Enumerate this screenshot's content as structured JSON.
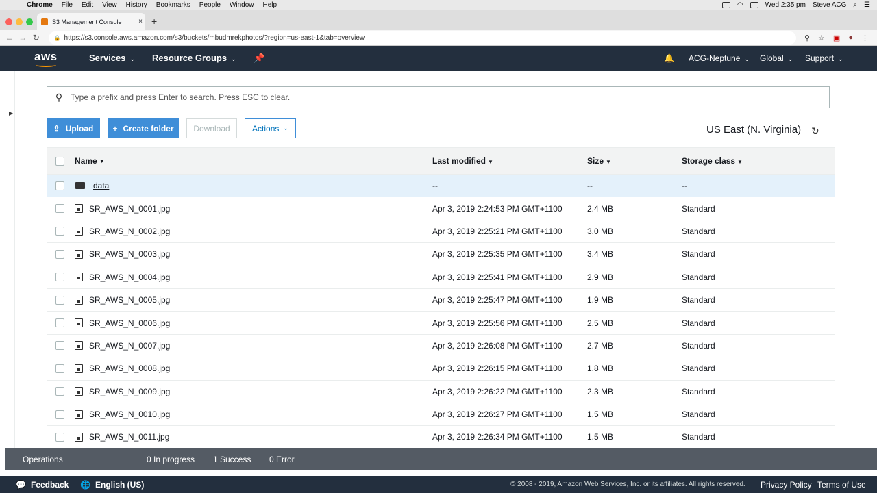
{
  "mac_menu": {
    "app": "Chrome",
    "items": [
      "File",
      "Edit",
      "View",
      "History",
      "Bookmarks",
      "People",
      "Window",
      "Help"
    ],
    "clock": "Wed 2:35 pm",
    "user": "Steve ACG"
  },
  "browser": {
    "tab_title": "S3 Management Console",
    "url": "https://s3.console.aws.amazon.com/s3/buckets/mbudmrekphotos/?region=us-east-1&tab=overview"
  },
  "aws_nav": {
    "logo": "aws",
    "services": "Services",
    "resource_groups": "Resource Groups",
    "account": "ACG-Neptune",
    "region": "Global",
    "support": "Support"
  },
  "search": {
    "placeholder": "Type a prefix and press Enter to search. Press ESC to clear."
  },
  "toolbar": {
    "upload": "Upload",
    "create_folder": "Create folder",
    "download": "Download",
    "actions": "Actions",
    "region_label": "US East (N. Virginia)"
  },
  "table": {
    "headers": {
      "name": "Name",
      "last_modified": "Last modified",
      "size": "Size",
      "storage_class": "Storage class"
    },
    "rows": [
      {
        "name": "data",
        "modified": "--",
        "size": "--",
        "class": "--"
      },
      {
        "name": "SR_AWS_N_0001.jpg",
        "modified": "Apr 3, 2019 2:24:53 PM GMT+1100",
        "size": "2.4 MB",
        "class": "Standard"
      },
      {
        "name": "SR_AWS_N_0002.jpg",
        "modified": "Apr 3, 2019 2:25:21 PM GMT+1100",
        "size": "3.0 MB",
        "class": "Standard"
      },
      {
        "name": "SR_AWS_N_0003.jpg",
        "modified": "Apr 3, 2019 2:25:35 PM GMT+1100",
        "size": "3.4 MB",
        "class": "Standard"
      },
      {
        "name": "SR_AWS_N_0004.jpg",
        "modified": "Apr 3, 2019 2:25:41 PM GMT+1100",
        "size": "2.9 MB",
        "class": "Standard"
      },
      {
        "name": "SR_AWS_N_0005.jpg",
        "modified": "Apr 3, 2019 2:25:47 PM GMT+1100",
        "size": "1.9 MB",
        "class": "Standard"
      },
      {
        "name": "SR_AWS_N_0006.jpg",
        "modified": "Apr 3, 2019 2:25:56 PM GMT+1100",
        "size": "2.5 MB",
        "class": "Standard"
      },
      {
        "name": "SR_AWS_N_0007.jpg",
        "modified": "Apr 3, 2019 2:26:08 PM GMT+1100",
        "size": "2.7 MB",
        "class": "Standard"
      },
      {
        "name": "SR_AWS_N_0008.jpg",
        "modified": "Apr 3, 2019 2:26:15 PM GMT+1100",
        "size": "1.8 MB",
        "class": "Standard"
      },
      {
        "name": "SR_AWS_N_0009.jpg",
        "modified": "Apr 3, 2019 2:26:22 PM GMT+1100",
        "size": "2.3 MB",
        "class": "Standard"
      },
      {
        "name": "SR_AWS_N_0010.jpg",
        "modified": "Apr 3, 2019 2:26:27 PM GMT+1100",
        "size": "1.5 MB",
        "class": "Standard"
      },
      {
        "name": "SR_AWS_N_0011.jpg",
        "modified": "Apr 3, 2019 2:26:34 PM GMT+1100",
        "size": "1.5 MB",
        "class": "Standard"
      }
    ]
  },
  "operations": {
    "label": "Operations",
    "in_progress": "0 In progress",
    "success": "1 Success",
    "error": "0 Error"
  },
  "footer": {
    "feedback": "Feedback",
    "language": "English (US)",
    "copyright": "© 2008 - 2019, Amazon Web Services, Inc. or its affiliates. All rights reserved.",
    "privacy": "Privacy Policy",
    "terms": "Terms of Use"
  },
  "colors": {
    "aws_nav_bg": "#232f3e",
    "primary_button": "#3f8ed8",
    "selected_row": "#e4f1fb",
    "ops_bar": "#545b64"
  }
}
